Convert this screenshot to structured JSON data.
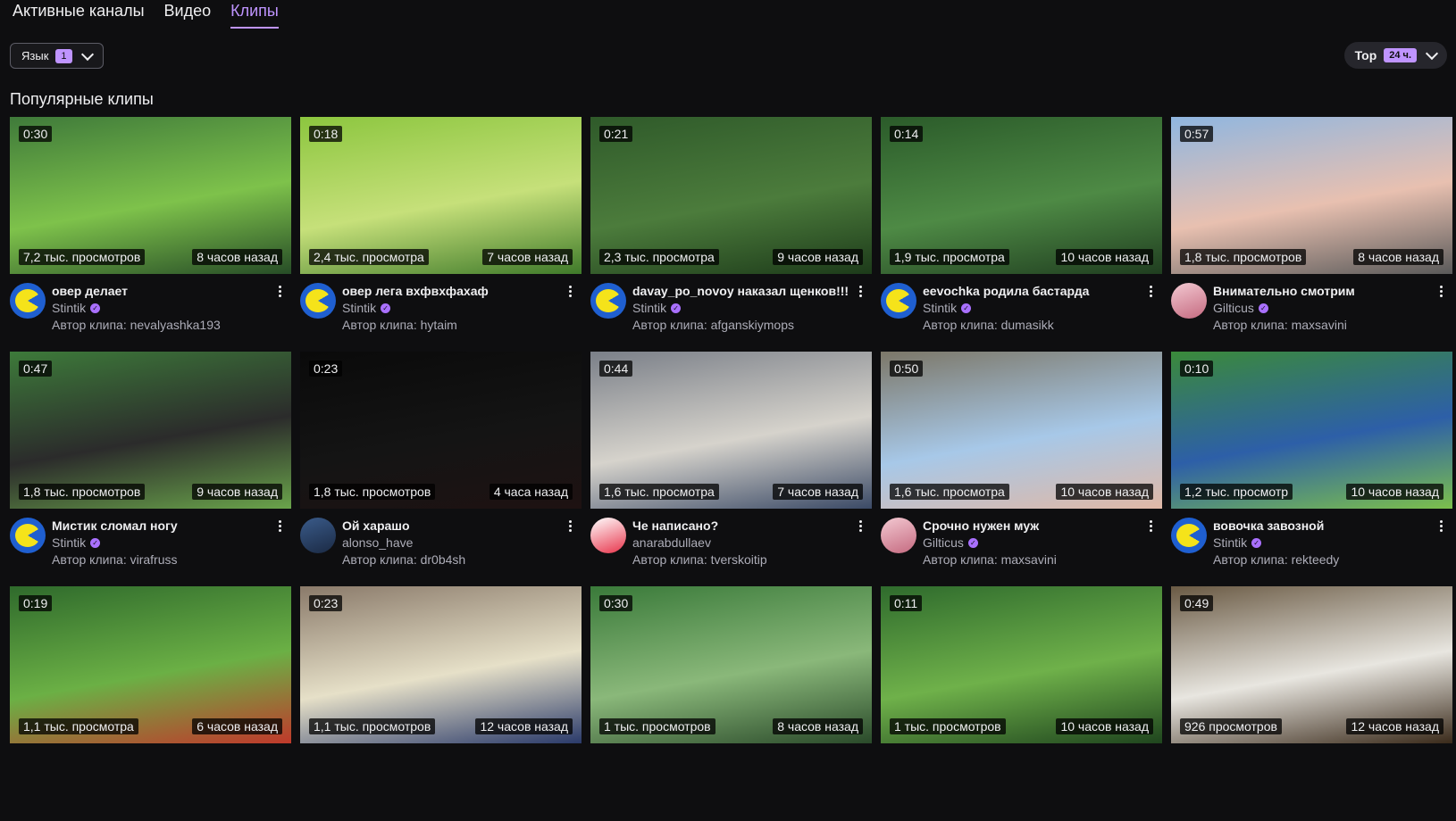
{
  "tabs": [
    {
      "label": "Активные каналы",
      "active": false
    },
    {
      "label": "Видео",
      "active": false
    },
    {
      "label": "Клипы",
      "active": true
    }
  ],
  "filters": {
    "language_label": "Язык",
    "language_count": "1",
    "sort_label": "Top",
    "sort_period": "24 ч."
  },
  "section_title": "Популярные клипы",
  "author_prefix": "Автор клипа:",
  "clips": [
    {
      "duration": "0:30",
      "views": "7,2 тыс. просмотров",
      "ago": "8 часов назад",
      "title": "овер делает",
      "channel": "Stintik",
      "verified": true,
      "author": "nevalyashka193",
      "avatar": "pacman",
      "thumb_colors": [
        "#3f7a3a",
        "#7ec24b",
        "#274d27"
      ]
    },
    {
      "duration": "0:18",
      "views": "2,4 тыс. просмотра",
      "ago": "7 часов назад",
      "title": "овер лега вхфвхфахаф",
      "channel": "Stintik",
      "verified": true,
      "author": "hytaim",
      "avatar": "pacman",
      "thumb_colors": [
        "#8cc63f",
        "#c6e07a",
        "#3f7a2a"
      ]
    },
    {
      "duration": "0:21",
      "views": "2,3 тыс. просмотра",
      "ago": "9 часов назад",
      "title": "davay_po_novoy наказал щенков!!!",
      "channel": "Stintik",
      "verified": true,
      "author": "afganskiymops",
      "avatar": "pacman",
      "thumb_colors": [
        "#2f5a2a",
        "#4c7c3c",
        "#1d3b1a"
      ]
    },
    {
      "duration": "0:14",
      "views": "1,9 тыс. просмотра",
      "ago": "10 часов назад",
      "title": "eevochka родила бастарда",
      "channel": "Stintik",
      "verified": true,
      "author": "dumasikk",
      "avatar": "pacman",
      "thumb_colors": [
        "#2b5b2a",
        "#4e8a45",
        "#203e20"
      ]
    },
    {
      "duration": "0:57",
      "views": "1,8 тыс. просмотров",
      "ago": "8 часов назад",
      "title": "Внимательно смотрим",
      "channel": "Gilticus",
      "verified": true,
      "author": "maxsavini",
      "avatar": "girl",
      "thumb_colors": [
        "#8fb6e0",
        "#e8c0b0",
        "#5a5a5a"
      ]
    },
    {
      "duration": "0:47",
      "views": "1,8 тыс. просмотров",
      "ago": "9 часов назад",
      "title": "Мистик сломал ногу",
      "channel": "Stintik",
      "verified": true,
      "author": "virafruss",
      "avatar": "pacman",
      "thumb_colors": [
        "#3d7a3a",
        "#2b2b2b",
        "#6aa44b"
      ]
    },
    {
      "duration": "0:23",
      "views": "1,8 тыс. просмотров",
      "ago": "4 часа назад",
      "title": "Ой харашо",
      "channel": "alonso_have",
      "verified": false,
      "author": "dr0b4sh",
      "avatar": "boy",
      "thumb_colors": [
        "#0a0a0a",
        "#141414",
        "#1e1212"
      ]
    },
    {
      "duration": "0:44",
      "views": "1,6 тыс. просмотра",
      "ago": "7 часов назад",
      "title": "Че написано?",
      "channel": "anarabdullaev",
      "verified": false,
      "author": "tverskoitip",
      "avatar": "red",
      "thumb_colors": [
        "#7a7f88",
        "#d6d3cc",
        "#3b4a66"
      ]
    },
    {
      "duration": "0:50",
      "views": "1,6 тыс. просмотра",
      "ago": "10 часов назад",
      "title": "Срочно нужен муж",
      "channel": "Gilticus",
      "verified": true,
      "author": "maxsavini",
      "avatar": "girl",
      "thumb_colors": [
        "#7c7768",
        "#a7c8e8",
        "#e0b8a6"
      ]
    },
    {
      "duration": "0:10",
      "views": "1,2 тыс. просмотр",
      "ago": "10 часов назад",
      "title": "вовочка завозной",
      "channel": "Stintik",
      "verified": true,
      "author": "rekteedy",
      "avatar": "pacman",
      "thumb_colors": [
        "#3b8a3a",
        "#2d5fa8",
        "#7cc04c"
      ]
    },
    {
      "duration": "0:19",
      "views": "1,1 тыс. просмотра",
      "ago": "6 часов назад",
      "title": "",
      "channel": "",
      "verified": false,
      "author": "",
      "avatar": "none",
      "thumb_colors": [
        "#2f6a2c",
        "#6bb045",
        "#c0392b"
      ]
    },
    {
      "duration": "0:23",
      "views": "1,1 тыс. просмотров",
      "ago": "12 часов назад",
      "title": "",
      "channel": "",
      "verified": false,
      "author": "",
      "avatar": "none",
      "thumb_colors": [
        "#8a7a6a",
        "#e6e0c8",
        "#2a3a6a"
      ]
    },
    {
      "duration": "0:30",
      "views": "1 тыс. просмотров",
      "ago": "8 часов назад",
      "title": "",
      "channel": "",
      "verified": false,
      "author": "",
      "avatar": "none",
      "thumb_colors": [
        "#3a7a3a",
        "#8ab87a",
        "#2a4a2a"
      ]
    },
    {
      "duration": "0:11",
      "views": "1 тыс. просмотров",
      "ago": "10 часов назад",
      "title": "",
      "channel": "",
      "verified": false,
      "author": "",
      "avatar": "none",
      "thumb_colors": [
        "#2f6b2d",
        "#6fb14a",
        "#1f451e"
      ]
    },
    {
      "duration": "0:49",
      "views": "926 просмотров",
      "ago": "12 часов назад",
      "title": "",
      "channel": "",
      "verified": false,
      "author": "",
      "avatar": "none",
      "thumb_colors": [
        "#6a5a44",
        "#e8e6e0",
        "#3a2a1a"
      ]
    }
  ]
}
